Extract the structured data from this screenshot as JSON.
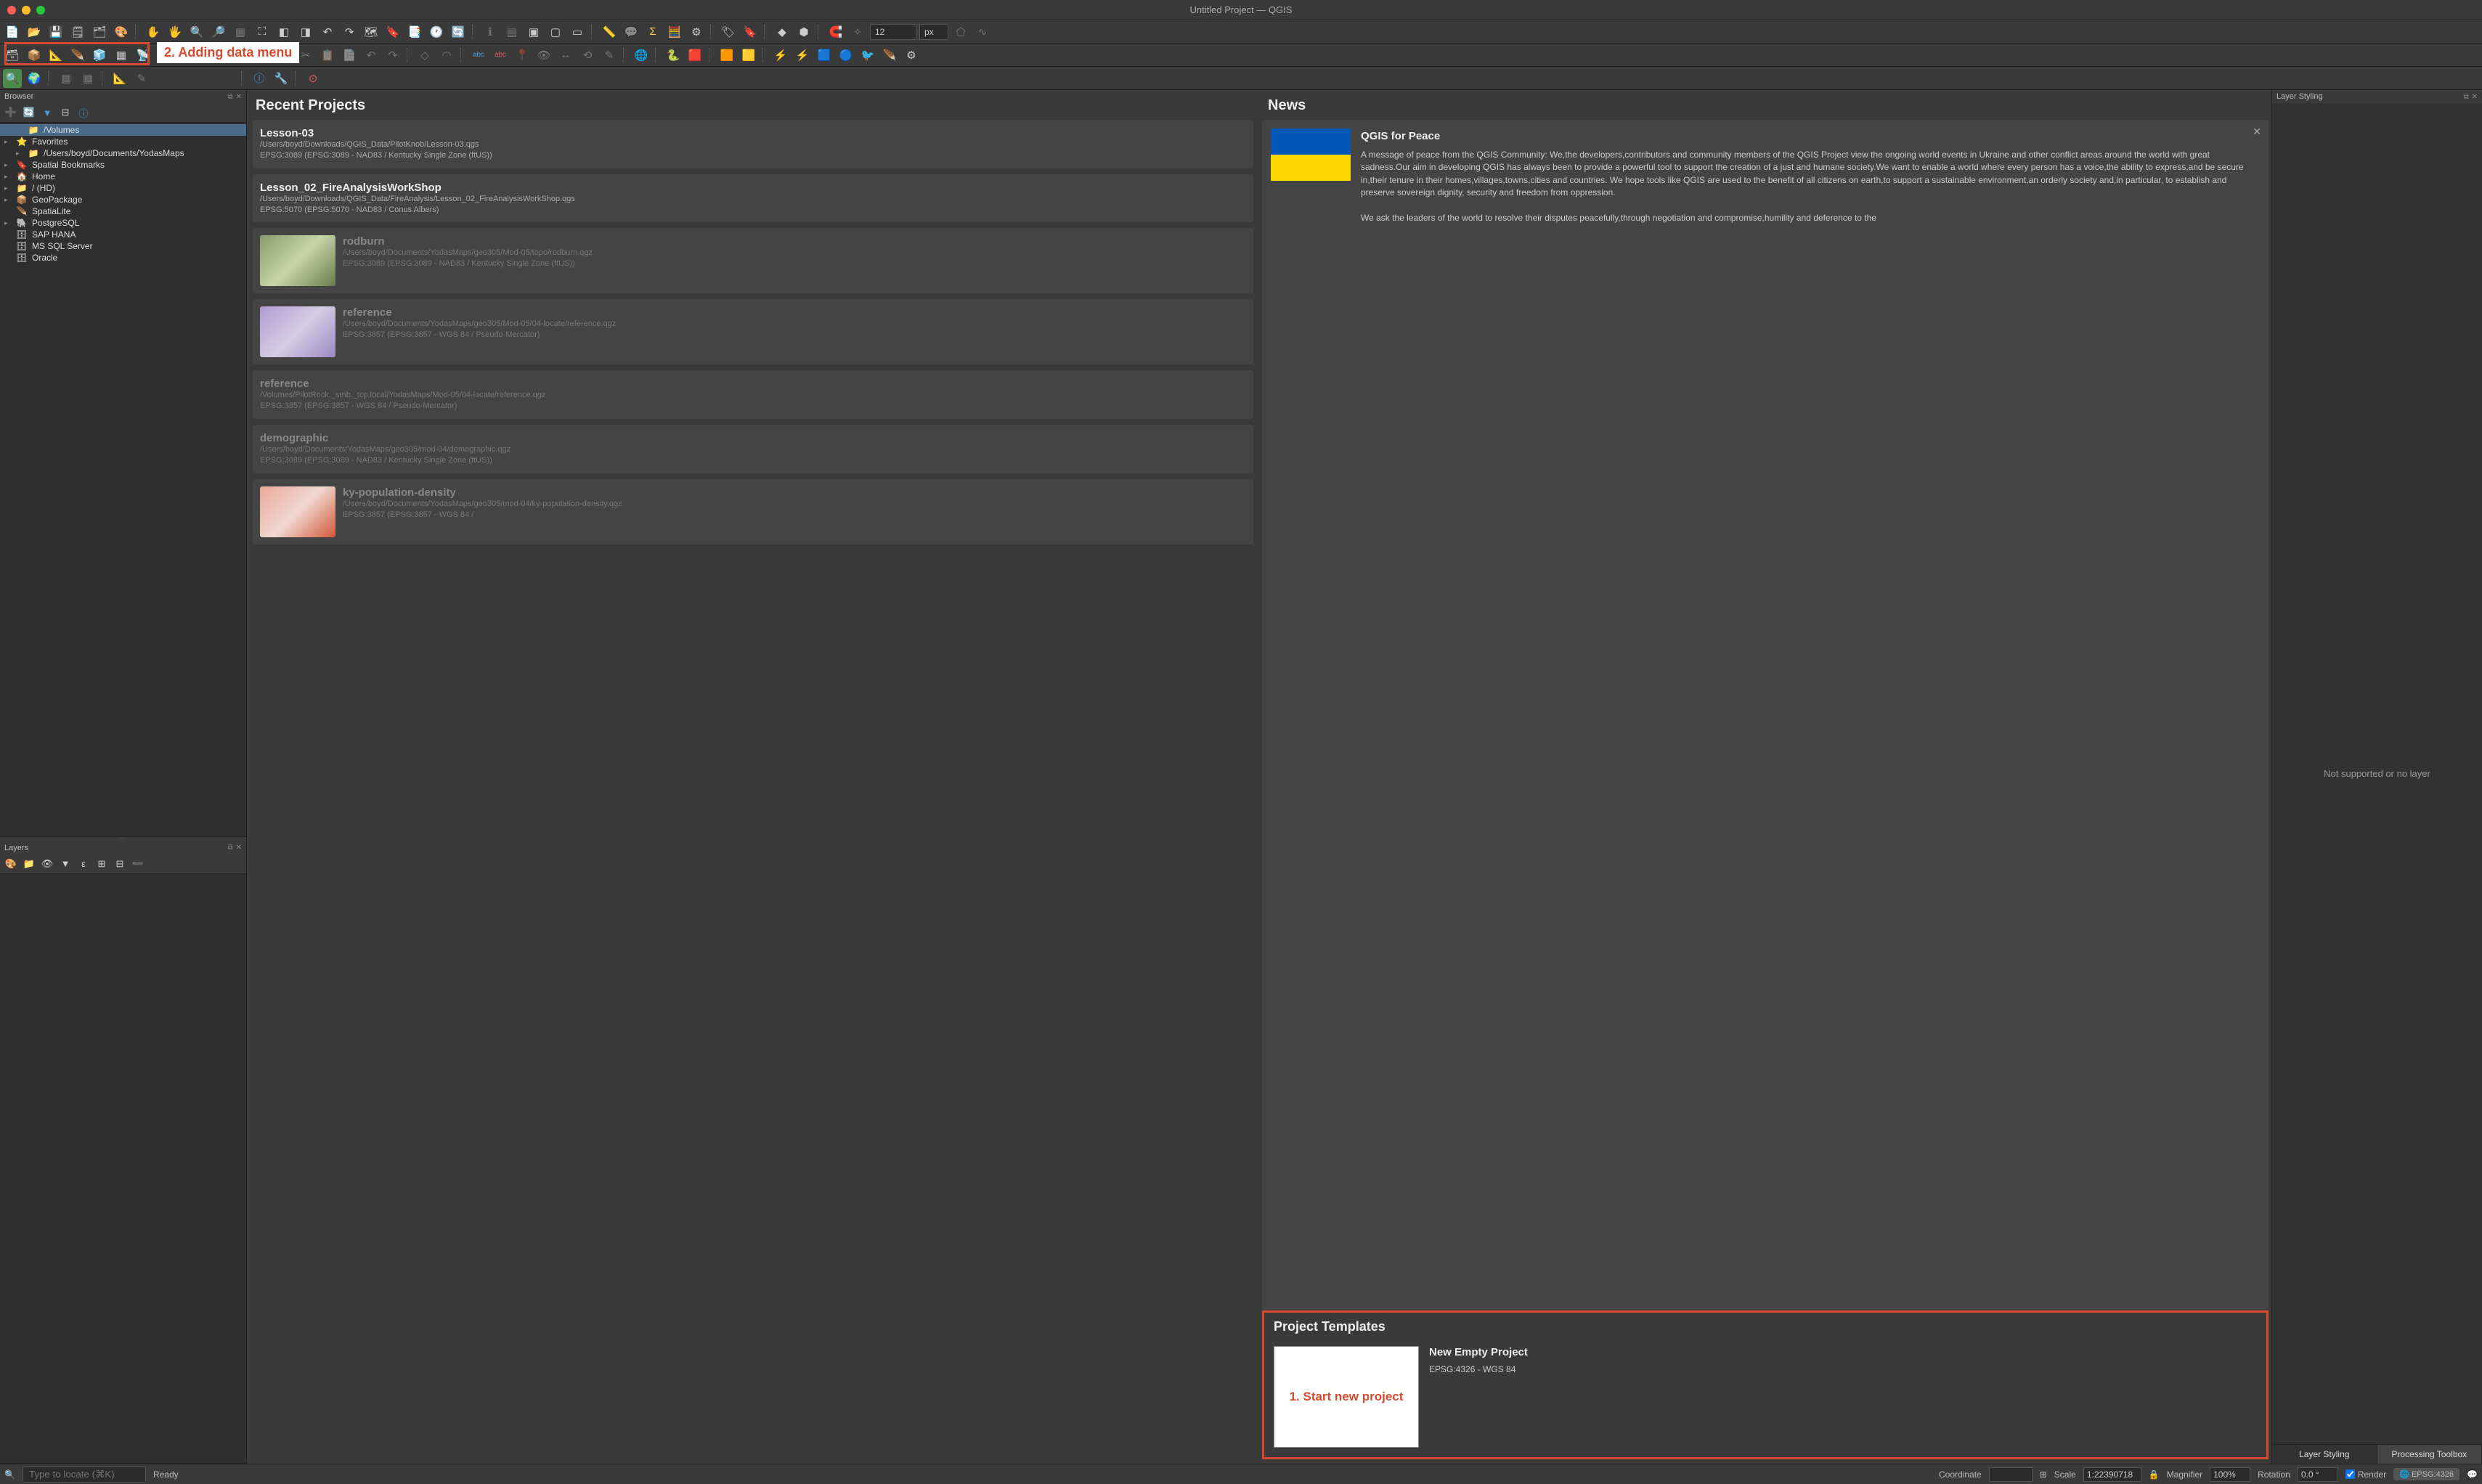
{
  "window": {
    "title": "Untitled Project — QGIS"
  },
  "panels": {
    "browser": {
      "title": "Browser"
    },
    "layers": {
      "title": "Layers"
    },
    "styling": {
      "title": "Layer Styling",
      "empty_msg": "Not supported or no layer"
    }
  },
  "browser_tree": [
    {
      "label": "/Volumes",
      "icon": "📁",
      "indent": 1,
      "arrow": ""
    },
    {
      "label": "Favorites",
      "icon": "⭐",
      "indent": 0,
      "arrow": "▸"
    },
    {
      "label": "/Users/boyd/Documents/YodasMaps",
      "icon": "📁",
      "indent": 1,
      "arrow": "▸"
    },
    {
      "label": "Spatial Bookmarks",
      "icon": "🔖",
      "indent": 0,
      "arrow": "▸"
    },
    {
      "label": "Home",
      "icon": "🏠",
      "indent": 0,
      "arrow": "▸"
    },
    {
      "label": "/ (HD)",
      "icon": "📁",
      "indent": 0,
      "arrow": "▸"
    },
    {
      "label": "GeoPackage",
      "icon": "📦",
      "indent": 0,
      "arrow": "▸"
    },
    {
      "label": "SpatiaLite",
      "icon": "🪶",
      "indent": 0,
      "arrow": ""
    },
    {
      "label": "PostgreSQL",
      "icon": "🐘",
      "indent": 0,
      "arrow": "▸"
    },
    {
      "label": "SAP HANA",
      "icon": "🗄",
      "indent": 0,
      "arrow": ""
    },
    {
      "label": "MS SQL Server",
      "icon": "🗄",
      "indent": 0,
      "arrow": ""
    },
    {
      "label": "Oracle",
      "icon": "🗄",
      "indent": 0,
      "arrow": ""
    }
  ],
  "recent": {
    "title": "Recent Projects",
    "items": [
      {
        "title": "Lesson-03",
        "path": "/Users/boyd/Downloads/QGIS_Data/PilotKnob/Lesson-03.qgs",
        "crs": "EPSG:3089 (EPSG:3089 - NAD83 / Kentucky Single Zone (ftUS))",
        "thumb": false,
        "dim": false
      },
      {
        "title": "Lesson_02_FireAnalysisWorkShop",
        "path": "/Users/boyd/Downloads/QGIS_Data/FireAnalysis/Lesson_02_FireAnalysisWorkShop.qgs",
        "crs": "EPSG:5070 (EPSG:5070 - NAD83 / Conus Albers)",
        "thumb": false,
        "dim": false
      },
      {
        "title": "rodburn",
        "path": "/Users/boyd/Documents/YodasMaps/geo305/Mod-05/topo/rodburn.qgz",
        "crs": "EPSG:3089 (EPSG:3089 - NAD83 / Kentucky Single Zone (ftUS))",
        "thumb": true,
        "thumb_bg": "linear-gradient(135deg,#8a9a6a,#c8d4a8,#6a7a4a)",
        "dim": true
      },
      {
        "title": "reference",
        "path": "/Users/boyd/Documents/YodasMaps/geo305/Mod-05/04-locate/reference.qgz",
        "crs": "EPSG:3857 (EPSG:3857 - WGS 84 / Pseudo-Mercator)",
        "thumb": true,
        "thumb_bg": "linear-gradient(135deg,#b49ad4,#d4cde4,#9a8ac4)",
        "dim": true
      },
      {
        "title": "reference",
        "path": "/Volumes/PilotRock._smb._tcp.local/YodasMaps/Mod-05/04-locate/reference.qgz",
        "crs": "EPSG:3857 (EPSG:3857 - WGS 84 / Pseudo-Mercator)",
        "thumb": false,
        "dim": true
      },
      {
        "title": "demographic",
        "path": "/Users/boyd/Documents/YodasMaps/geo305/mod-04/demographic.qgz",
        "crs": "EPSG:3089 (EPSG:3089 - NAD83 / Kentucky Single Zone (ftUS))",
        "thumb": false,
        "dim": true
      },
      {
        "title": "ky-population-density",
        "path": "/Users/boyd/Documents/YodasMaps/geo305/mod-04/ky-population-density.qgz",
        "crs": "EPSG:3857 (EPSG:3857 - WGS 84 /",
        "thumb": true,
        "thumb_bg": "linear-gradient(135deg,#e8a898,#f0d8d0,#d05838)",
        "dim": true
      }
    ]
  },
  "news": {
    "title": "News",
    "item": {
      "heading": "QGIS for Peace",
      "body1": "A message of peace from the QGIS Community: We,the developers,contributors and community members of the QGIS Project view the ongoing world events in Ukraine and other conflict areas around the world with great sadness.Our aim in developing QGIS has always been to provide a powerful tool to support the creation of a just and humane society.We want to enable a world where every person has a voice,the ability to express,and be secure in,their tenure in their homes,villages,towns,cities and countries. We hope tools like QGIS are used to the benefit of all citizens on earth,to support a sustainable environment,an orderly society and,in particular, to establish and preserve sovereign dignity, security and freedom from oppression.",
      "body2": "We ask the leaders of the world to resolve their disputes peacefully,through negotiation and compromise,humility and deference to the"
    }
  },
  "templates": {
    "title": "Project Templates",
    "item": {
      "title": "New Empty Project",
      "crs": "EPSG:4326 - WGS 84"
    }
  },
  "right_tabs": {
    "a": "Layer Styling",
    "b": "Processing Toolbox"
  },
  "status": {
    "locate_placeholder": "Type to locate (⌘K)",
    "ready": "Ready",
    "coord_label": "Coordinate",
    "scale_label": "Scale",
    "scale_value": "1:22390718",
    "mag_label": "Magnifier",
    "mag_value": "100%",
    "rot_label": "Rotation",
    "rot_value": "0.0 °",
    "render_label": "Render",
    "crs": "EPSG:4326"
  },
  "toolbar_number": "12",
  "toolbar_unit": "px",
  "annotations": {
    "a1": "2. Adding data menu",
    "a2": "1. Start new project"
  }
}
